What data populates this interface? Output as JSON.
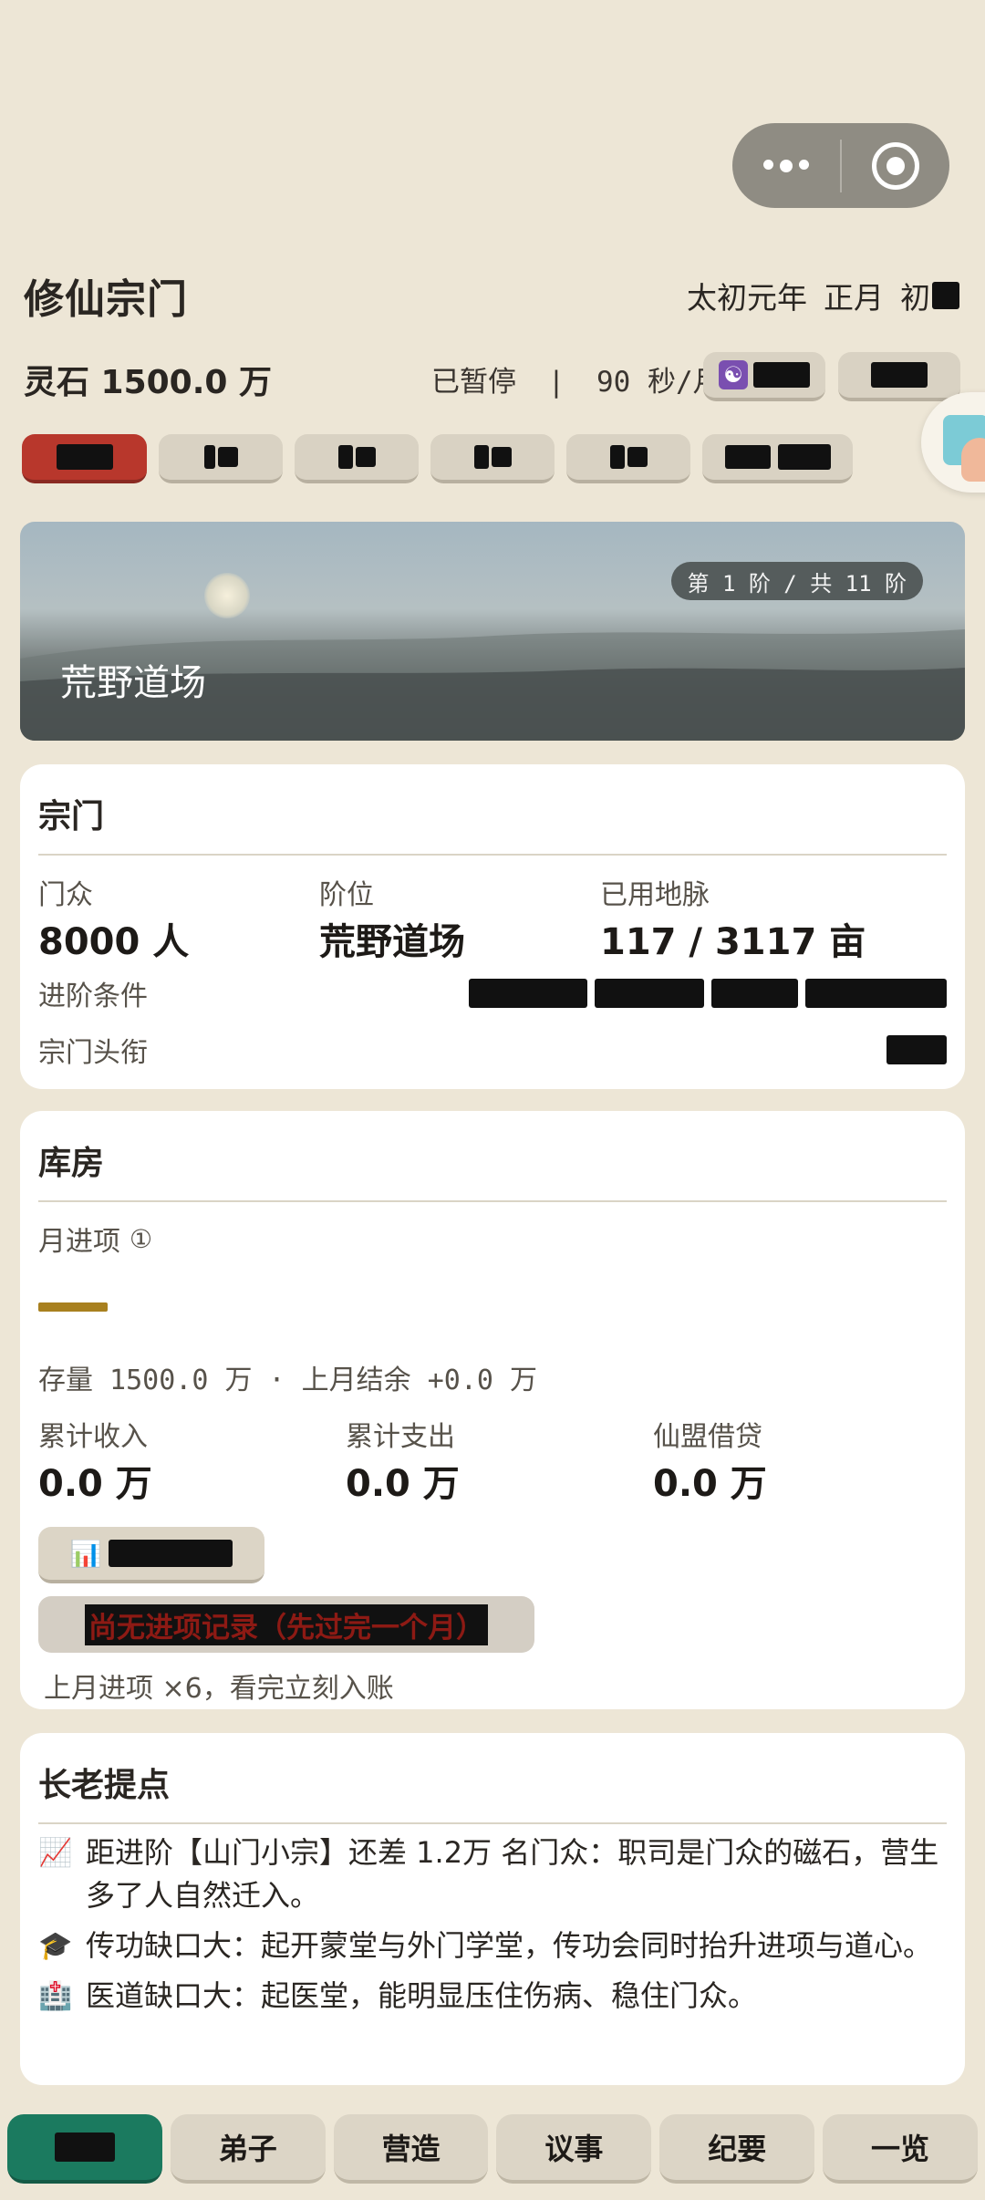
{
  "app": {
    "title": "修仙宗门",
    "date": [
      "太初元年",
      "正月",
      "初■"
    ]
  },
  "status": {
    "spirit_stones": "灵石 1500.0 万",
    "paused": "已暂停",
    "separator": "|",
    "speed": "90 秒/月",
    "btn_a_icon": "yin-yang-icon",
    "btn_a_label": "■■",
    "btn_b_label": "■■"
  },
  "speed_chips": [
    "■■",
    "1■",
    "2■",
    "3■",
    "4■",
    "10■ ■■"
  ],
  "banner": {
    "tier_badge": "第 1 阶 / 共 11 阶",
    "place": "荒野道场"
  },
  "sect": {
    "heading": "宗门",
    "members_label": "门众",
    "members_value": "8000 人",
    "rank_label": "阶位",
    "rank_value": "荒野道场",
    "land_label": "已用地脉",
    "land_value": "117 / 3117 亩",
    "advance_label": "进阶条件",
    "advance_value": "■■小宗 ■■■ ■.■ ■■, ■ ■■■■ ■■",
    "title_label": "宗门头衔",
    "title_value": "■■"
  },
  "storehouse": {
    "heading": "库房",
    "monthly_label": "月进项",
    "info_icon": "①",
    "stock_line": "存量 1500.0 万 · 上月结余 +0.0 万",
    "income_label": "累计收入",
    "income_value": "0.0 万",
    "expense_label": "累计支出",
    "expense_value": "0.0 万",
    "loan_label": "仙盟借贷",
    "loan_value": "0.0 万",
    "detail_button": "收支明细",
    "empty_notice": "尚无进项记录（先过完一个月）",
    "footnote": "上月进项 ×6，看完立刻入账"
  },
  "elder_tips": {
    "heading": "长老提点",
    "items": [
      {
        "icon": "chart-up-icon",
        "glyph": "📈",
        "text": "距进阶【山门小宗】还差 1.2万 名门众：职司是门众的磁石，营生多了人自然迁入。"
      },
      {
        "icon": "graduation-cap-icon",
        "glyph": "🎓",
        "text": "传功缺口大：起开蒙堂与外门学堂，传功会同时抬升进项与道心。"
      },
      {
        "icon": "hospital-icon",
        "glyph": "🏥",
        "text": "医道缺口大：起医堂，能明显压住伤病、稳住门众。"
      }
    ]
  },
  "bottom_nav": [
    "■■",
    "弟子",
    "营造",
    "议事",
    "纪要",
    "一览"
  ],
  "colors": {
    "background": "#ede6d6",
    "active_chip": "#b8372c",
    "active_nav": "#1b7a5f",
    "gold_bar": "#a8801f"
  }
}
